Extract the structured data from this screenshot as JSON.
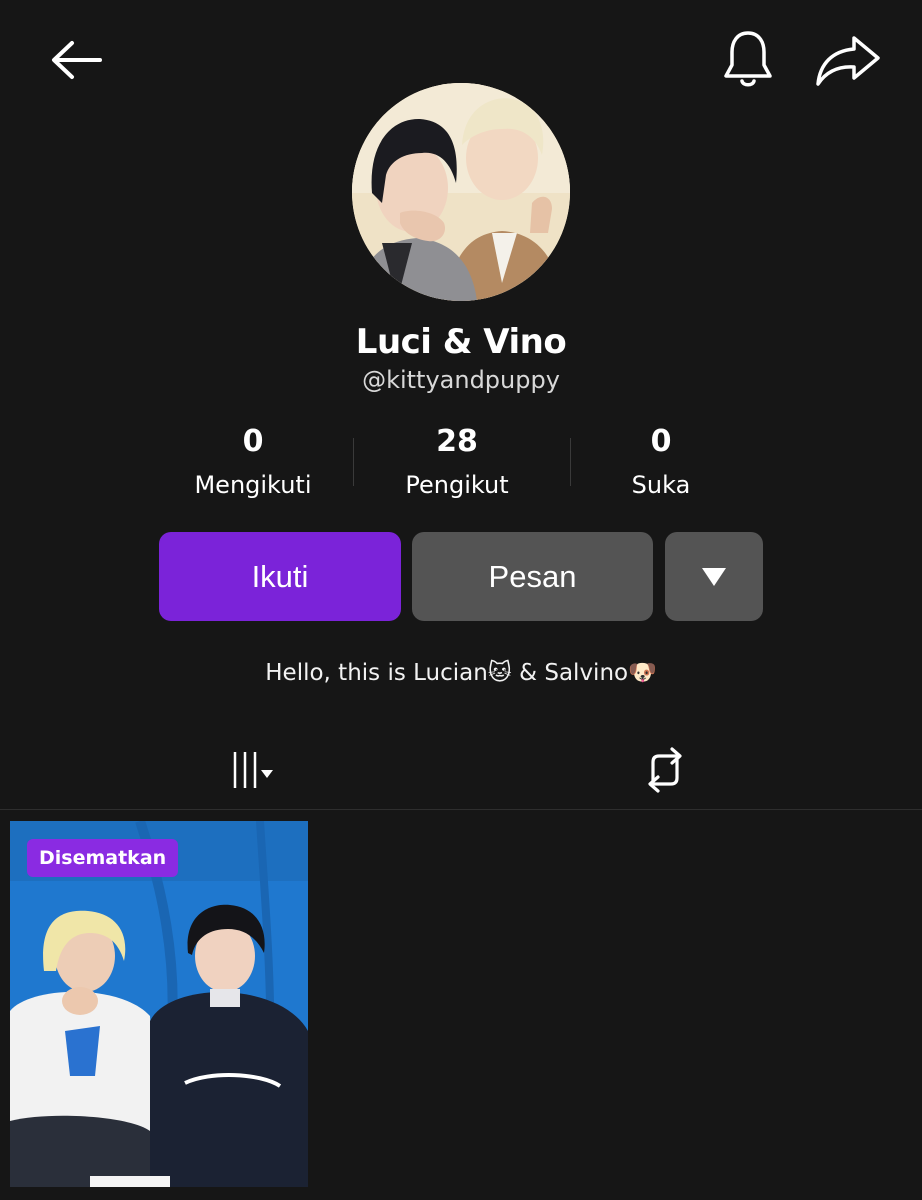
{
  "header": {
    "back_icon": "arrow-left-icon",
    "notification_icon": "bell-icon",
    "share_icon": "share-arrow-icon"
  },
  "profile": {
    "display_name": "Luci & Vino",
    "username": "@kittyandpuppy",
    "avatar": "profile-photo"
  },
  "stats": [
    {
      "value": "0",
      "label": "Mengikuti"
    },
    {
      "value": "28",
      "label": "Pengikut"
    },
    {
      "value": "0",
      "label": "Suka"
    }
  ],
  "actions": {
    "follow_label": "Ikuti",
    "message_label": "Pesan",
    "more_icon": "triangle-down-icon"
  },
  "bio": "Hello, this is Lucian🐱 & Salvino🐶",
  "tabs": {
    "videos_icon": "grid-bars-icon",
    "repost_icon": "repost-icon"
  },
  "videos": [
    {
      "badge": "Disematkan",
      "thumbnail": "video-thumbnail"
    }
  ],
  "colors": {
    "background": "#161616",
    "accent": "#7b23d9",
    "secondary_button": "#545454",
    "pinned_badge": "#8a2be2"
  }
}
